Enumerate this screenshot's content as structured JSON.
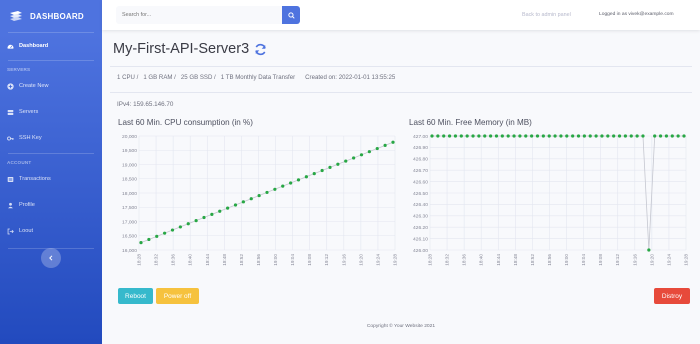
{
  "sidebar": {
    "brand": "DASHBOARD",
    "items": [
      {
        "label": "Dashboard",
        "icon": "tachometer-icon",
        "active": true
      },
      {
        "label": "Create New",
        "icon": "plus-circle-icon"
      },
      {
        "label": "Servers",
        "icon": "server-icon"
      },
      {
        "label": "SSH Key",
        "icon": "key-icon"
      },
      {
        "label": "Transactions",
        "icon": "list-icon"
      },
      {
        "label": "Profile",
        "icon": "user-icon"
      },
      {
        "label": "Loout",
        "icon": "sign-out-icon"
      }
    ],
    "sections": {
      "servers": "SERVERS",
      "account": "ACCOUNT"
    },
    "toggle_icon": "chevron-left-icon"
  },
  "topbar": {
    "search_placeholder": "Search for...",
    "back_link": "Back to admin panel",
    "logged_in": "Logged in as vivek@example.com"
  },
  "server": {
    "name": "My-First-API-Server3",
    "cpu": "1 CPU /",
    "ram": "1 GB RAM /",
    "ssd": "25 GB SSD /",
    "transfer": "1 TB Monthly Data Transfer",
    "created": "Created on: 2022-01-01 13:55:25",
    "ipv4": "IPv4: 159.65.146.70"
  },
  "actions": {
    "reboot": "Reboot",
    "power_off": "Power off",
    "destroy": "Distroy"
  },
  "footer": "Copyright © Your Website 2021",
  "colors": {
    "primary": "#4e73df",
    "line": "#28a745",
    "info": "#36b9cc",
    "warning": "#f6c23e",
    "danger": "#e74a3b"
  },
  "chart_data": [
    {
      "type": "line",
      "title": "Last 60 Min. CPU consumption (in %)",
      "x": [
        "18:28",
        "18:32",
        "18:36",
        "18:40",
        "18:44",
        "18:48",
        "18:52",
        "18:56",
        "19:00",
        "19:04",
        "19:08",
        "19:12",
        "19:16",
        "19:20",
        "19:24",
        "19:28"
      ],
      "ylim": [
        16000,
        20000
      ],
      "yticks": [
        "16,000",
        "16,500",
        "17,000",
        "17,500",
        "18,000",
        "18,500",
        "19,000",
        "19,500",
        "20,000"
      ],
      "grid": true,
      "series": [
        {
          "values": [
            16260,
            16370,
            16480,
            16590,
            16700,
            16810,
            16920,
            17030,
            17140,
            17250,
            17360,
            17470,
            17580,
            17690,
            17800,
            17910,
            18020,
            18130,
            18240,
            18350,
            18460,
            18570,
            18680,
            18790,
            18900,
            19010,
            19120,
            19230,
            19340,
            19450,
            19560,
            19670,
            19780
          ]
        }
      ]
    },
    {
      "type": "line",
      "title": "Last 60 Min. Free Memory (in MB)",
      "x": [
        "18:28",
        "18:32",
        "18:36",
        "18:40",
        "18:44",
        "18:48",
        "18:52",
        "18:56",
        "19:00",
        "19:04",
        "19:08",
        "19:12",
        "19:16",
        "19:20",
        "19:24",
        "19:28"
      ],
      "ylim": [
        426,
        427
      ],
      "yticks": [
        "426.00",
        "426.10",
        "426.20",
        "426.30",
        "426.40",
        "426.50",
        "426.60",
        "426.70",
        "426.80",
        "426.90",
        "427.00"
      ],
      "grid": true,
      "series": [
        {
          "values": [
            427,
            427,
            427,
            427,
            427,
            427,
            427,
            427,
            427,
            427,
            427,
            427,
            427,
            427,
            427,
            427,
            427,
            427,
            427,
            427,
            427,
            427,
            427,
            427,
            427,
            427,
            427,
            427,
            427,
            427,
            427,
            427,
            427,
            427,
            427,
            427,
            427,
            426,
            427,
            427,
            427,
            427,
            427,
            427
          ]
        }
      ]
    }
  ]
}
